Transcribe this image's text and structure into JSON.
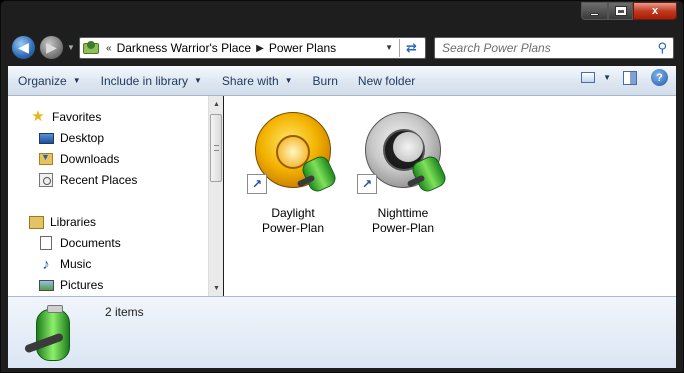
{
  "window": {
    "caption_buttons": {
      "minimize": "minimize",
      "maximize": "maximize",
      "close": "x"
    }
  },
  "nav": {
    "back_glyph": "◀",
    "forward_glyph": "▶",
    "history_glyph": "▼",
    "address": {
      "overflow": "«",
      "crumbs": [
        "Darkness Warrior's Place",
        "Power Plans"
      ],
      "separator": "▶",
      "dropdown_glyph": "▼",
      "refresh_glyph": "⇄"
    },
    "search": {
      "placeholder": "Search Power Plans",
      "value": ""
    }
  },
  "toolbar": {
    "items": [
      {
        "label": "Organize",
        "has_dropdown": true
      },
      {
        "label": "Include in library",
        "has_dropdown": true
      },
      {
        "label": "Share with",
        "has_dropdown": true
      },
      {
        "label": "Burn",
        "has_dropdown": false
      },
      {
        "label": "New folder",
        "has_dropdown": false
      }
    ],
    "dropdown_glyph": "▼",
    "view_dropdown_glyph": "▼",
    "help_glyph": "?"
  },
  "sidebar": {
    "items": [
      {
        "label": "Favorites",
        "icon": "star-icon"
      },
      {
        "label": "Desktop",
        "icon": "desktop-icon"
      },
      {
        "label": "Downloads",
        "icon": "downloads-icon"
      },
      {
        "label": "Recent Places",
        "icon": "recent-places-icon"
      },
      {
        "label": "Libraries",
        "icon": "libraries-icon"
      },
      {
        "label": "Documents",
        "icon": "documents-icon"
      },
      {
        "label": "Music",
        "icon": "music-icon"
      },
      {
        "label": "Pictures",
        "icon": "pictures-icon"
      }
    ],
    "scroll_up_glyph": "▲",
    "scroll_down_glyph": "▼"
  },
  "files": [
    {
      "line1": "Daylight",
      "line2": "Power-Plan",
      "icon": "daylight-power-plan-icon"
    },
    {
      "line1": "Nighttime",
      "line2": "Power-Plan",
      "icon": "nighttime-power-plan-icon"
    }
  ],
  "shortcut_glyph": "↗",
  "details": {
    "count": "2 items"
  }
}
